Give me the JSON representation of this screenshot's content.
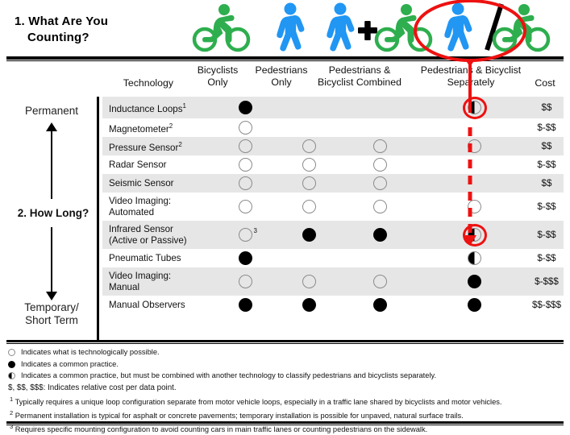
{
  "questions": {
    "q1_line1": "1. What Are You",
    "q1_line2": "Counting?",
    "q2": "2. How Long?"
  },
  "duration_axis": {
    "top_label": "Permanent",
    "bottom_label_line1": "Temporary/",
    "bottom_label_line2": "Short Term"
  },
  "icons": [
    {
      "name": "bicyclist-green-icon",
      "label": "bicyclist"
    },
    {
      "name": "pedestrian-blue-icon",
      "label": "pedestrian"
    },
    {
      "name": "pedestrian-plus-bicyclist-icon",
      "label": "pedestrian + bicyclist"
    },
    {
      "name": "pedestrian-slash-bicyclist-icon",
      "label": "pedestrian / bicyclist"
    }
  ],
  "columns": {
    "technology": "Technology",
    "bicyclists_only_l1": "Bicyclists",
    "bicyclists_only_l2": "Only",
    "pedestrians_only_l1": "Pedestrians",
    "pedestrians_only_l2": "Only",
    "combined_l1": "Pedestrians &",
    "combined_l2": "Bicyclist Combined",
    "separately_l1": "Pedestrians & Bicyclist",
    "separately_l2": "Separately",
    "cost": "Cost"
  },
  "rows": [
    {
      "tech": "Inductance Loops",
      "sup": "1",
      "tech_l2": "",
      "bicyclists": "filled",
      "pedestrians": "none",
      "combined": "none",
      "separately": "half",
      "cost": "$$",
      "highlight": true
    },
    {
      "tech": "Magnetometer",
      "sup": "2",
      "tech_l2": "",
      "bicyclists": "open",
      "pedestrians": "none",
      "combined": "none",
      "separately": "none",
      "cost": "$-$$",
      "highlight": false
    },
    {
      "tech": "Pressure Sensor",
      "sup": "2",
      "tech_l2": "",
      "bicyclists": "open",
      "pedestrians": "open",
      "combined": "open",
      "separately": "open",
      "cost": "$$",
      "highlight": false
    },
    {
      "tech": "Radar Sensor",
      "sup": "",
      "tech_l2": "",
      "bicyclists": "open",
      "pedestrians": "open",
      "combined": "open",
      "separately": "none",
      "cost": "$-$$",
      "highlight": false
    },
    {
      "tech": "Seismic Sensor",
      "sup": "",
      "tech_l2": "",
      "bicyclists": "open",
      "pedestrians": "open",
      "combined": "open",
      "separately": "none",
      "cost": "$$",
      "highlight": false
    },
    {
      "tech": "Video Imaging:",
      "sup": "",
      "tech_l2": "Automated",
      "bicyclists": "open",
      "pedestrians": "open",
      "combined": "open",
      "separately": "open",
      "cost": "$-$$",
      "highlight": false
    },
    {
      "tech": "Infrared Sensor",
      "sup": "",
      "tech_l2": "(Active or Passive)",
      "bicyclists": "open",
      "bicyclists_sup": "3",
      "pedestrians": "filled",
      "combined": "filled",
      "separately": "half",
      "cost": "$-$$",
      "highlight": true
    },
    {
      "tech": "Pneumatic Tubes",
      "sup": "",
      "tech_l2": "",
      "bicyclists": "filled",
      "pedestrians": "none",
      "combined": "none",
      "separately": "half",
      "cost": "$-$$",
      "highlight": false
    },
    {
      "tech": "Video Imaging:",
      "sup": "",
      "tech_l2": "Manual",
      "bicyclists": "open",
      "pedestrians": "open",
      "combined": "open",
      "separately": "filled",
      "cost": "$-$$$",
      "highlight": false
    },
    {
      "tech": "Manual Observers",
      "sup": "",
      "tech_l2": "",
      "bicyclists": "filled",
      "pedestrians": "filled",
      "combined": "filled",
      "separately": "filled",
      "cost": "$$-$$$",
      "highlight": false
    }
  ],
  "legend": {
    "open": "Indicates what is technologically possible.",
    "filled": "Indicates a common practice.",
    "half": "Indicates a common practice, but must be combined with another technology to classify pedestrians and bicyclists separately.",
    "cost": "$, $$, $$$:  Indicates relative cost per data point.",
    "note1_sup": "1",
    "note1": "Typically requires a unique loop configuration separate from motor vehicle loops, especially in a traffic lane shared by bicyclists and motor vehicles.",
    "note2_sup": "2",
    "note2": "Permanent installation is typical for asphalt or concrete pavements; temporary installation is possible for unpaved, natural surface trails.",
    "note3_sup": "3",
    "note3": "Requires specific mounting configuration to avoid counting cars in main traffic lanes or counting pedestrians on the sidewalk."
  },
  "colors": {
    "highlight_red": "#ee1111",
    "bicyclist_green": "#2eae4e",
    "pedestrian_blue": "#2196f3",
    "row_alt": "#e6e6e6",
    "symbol_outline": "#8b8b8b"
  }
}
